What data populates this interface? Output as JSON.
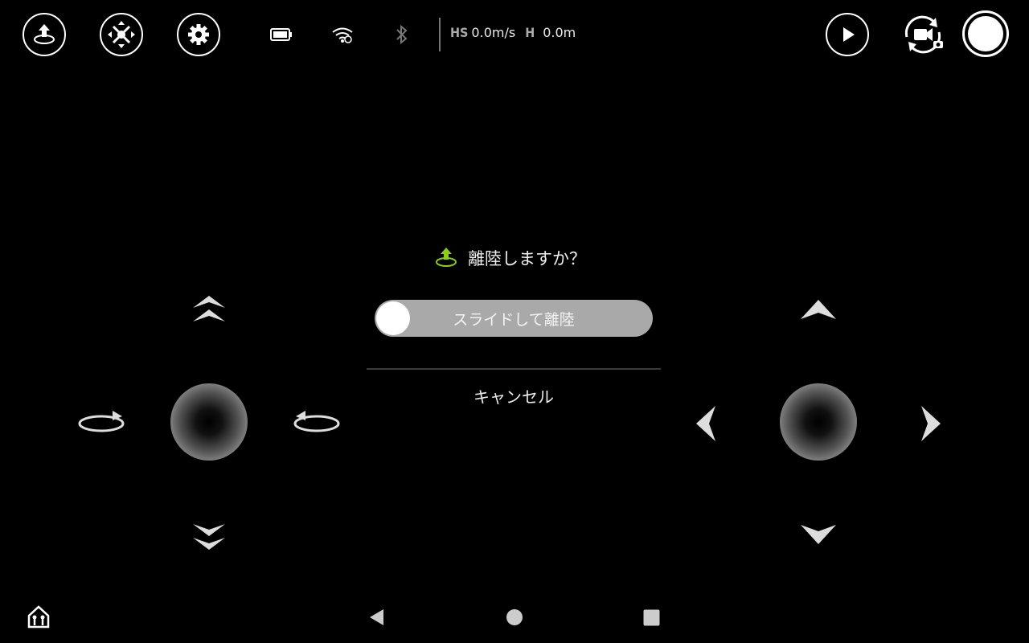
{
  "toolbar": {
    "takeoff_icon": "takeoff-icon",
    "drone_icon": "drone-icon",
    "settings_icon": "gear-icon",
    "battery_icon": "battery-icon",
    "wifi_icon": "wifi-icon",
    "bluetooth_icon": "bluetooth-icon"
  },
  "telemetry": {
    "hs_label": "HS",
    "hs_value": "0.0m/s",
    "h_label": "H",
    "h_value": "0.0m"
  },
  "dialog": {
    "title": "離陸しますか？",
    "slider_label": "スライドして離陸",
    "cancel_label": "キャンセル"
  },
  "colors": {
    "accent_green": "#8ccc1a",
    "slider_track": "#a9a9a9"
  },
  "navbar": {
    "back_icon": "back-triangle-icon",
    "home_icon": "home-circle-icon",
    "recents_icon": "recents-square-icon"
  }
}
